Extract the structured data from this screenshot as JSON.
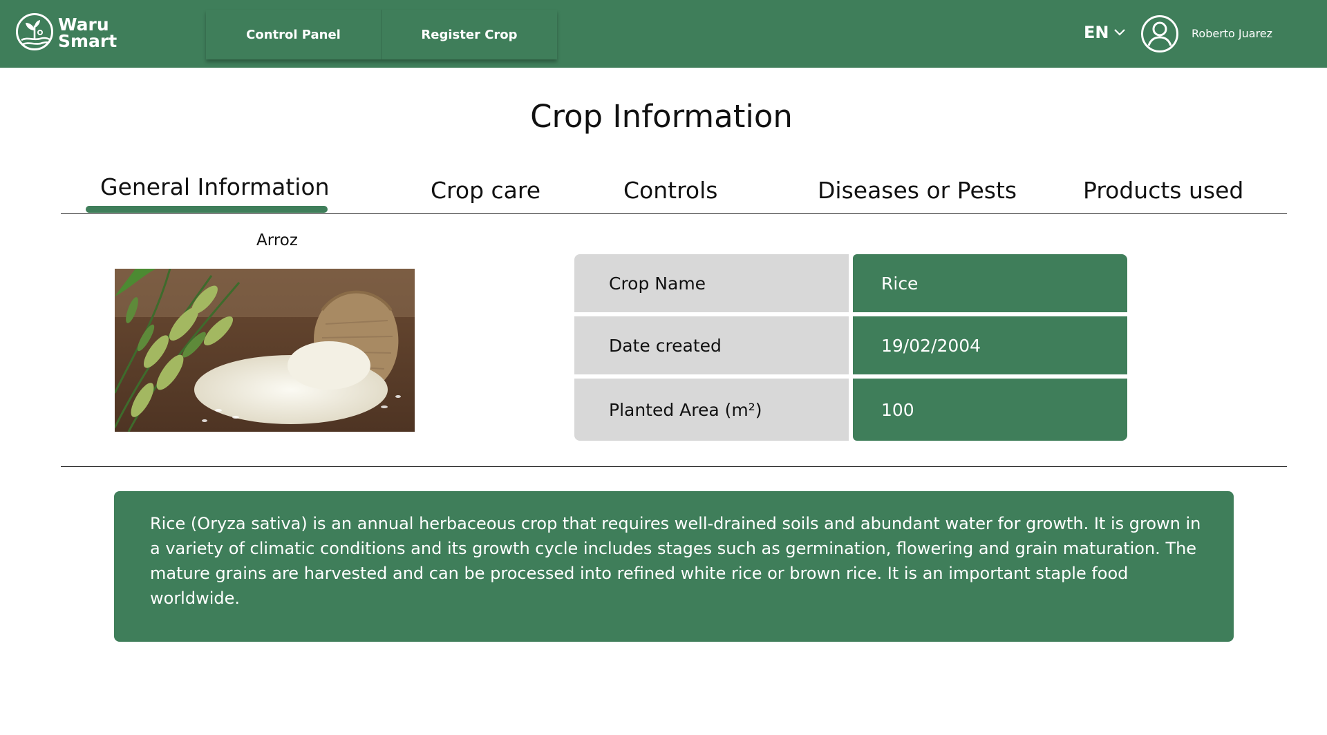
{
  "brand": {
    "line1": "Waru",
    "line2": "Smart",
    "color": "#3f7e5a"
  },
  "nav": {
    "items": [
      {
        "label": "Control Panel"
      },
      {
        "label": "Register Crop"
      }
    ]
  },
  "header": {
    "language": "EN",
    "user_name": "Roberto Juarez",
    "avatar_icon": "user-circle-icon",
    "language_icon": "chevron-down-icon"
  },
  "page": {
    "title": "Crop Information"
  },
  "tabs": [
    {
      "label": "General Information",
      "active": true
    },
    {
      "label": "Crop care",
      "active": false
    },
    {
      "label": "Controls",
      "active": false
    },
    {
      "label": "Diseases or Pests",
      "active": false
    },
    {
      "label": "Products used",
      "active": false
    }
  ],
  "crop": {
    "caption": "Arroz",
    "image_icon": "rice-photo",
    "fields": [
      {
        "label": "Crop Name",
        "value": "Rice"
      },
      {
        "label": "Date created",
        "value": "19/02/2004"
      },
      {
        "label": "Planted Area (m²)",
        "value": "100"
      }
    ],
    "description": "Rice (Oryza sativa) is an annual herbaceous crop that requires well-drained soils and abundant water for growth. It is grown in a variety of climatic conditions and its growth cycle includes stages such as germination, flowering and grain maturation. The mature grains are harvested and can be processed into refined white rice or brown rice. It is an important staple food worldwide."
  }
}
